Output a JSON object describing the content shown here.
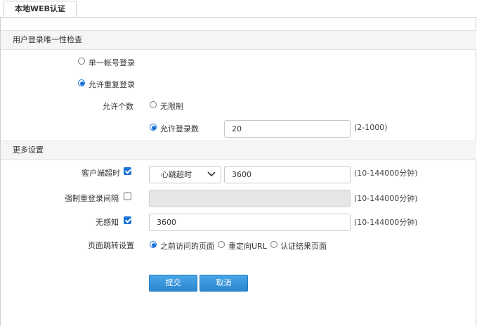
{
  "tabs": [
    {
      "label": "本地WEB认证"
    }
  ],
  "section_login": {
    "title": "用户登录唯一性检查",
    "single_login": "单一帐号登录",
    "allow_repeat_login": "允许重复登录",
    "allow_count_label": "允许个数",
    "unlimited": "无限制",
    "allowed_logins": "允许登录数",
    "allowed_logins_value": "20",
    "allowed_logins_range": "(2-1000)"
  },
  "section_more": {
    "title": "更多设置",
    "client_timeout_label": "客户端超时",
    "client_timeout_checked": true,
    "timeout_mode": "心跳超时",
    "client_timeout_value": "3600",
    "client_timeout_range": "(10-144000分钟)",
    "force_relogin_label": "强制重登录间隔",
    "force_relogin_checked": false,
    "force_relogin_value": "",
    "force_relogin_range": "(10-144000分钟)",
    "seamless_label": "无感知",
    "seamless_checked": true,
    "seamless_value": "3600",
    "seamless_range": "(10-144000分钟)",
    "redirect_label": "页面跳转设置",
    "redirect_options": [
      "之前访问的页面",
      "重定向URL",
      "认证结果页面"
    ],
    "redirect_selected": "之前访问的页面"
  },
  "actions": {
    "submit": "提交",
    "cancel": "取消"
  },
  "colors": {
    "accent": "#1a73d9",
    "button": "#3a97dc",
    "section_bg": "#f5f5f5"
  }
}
